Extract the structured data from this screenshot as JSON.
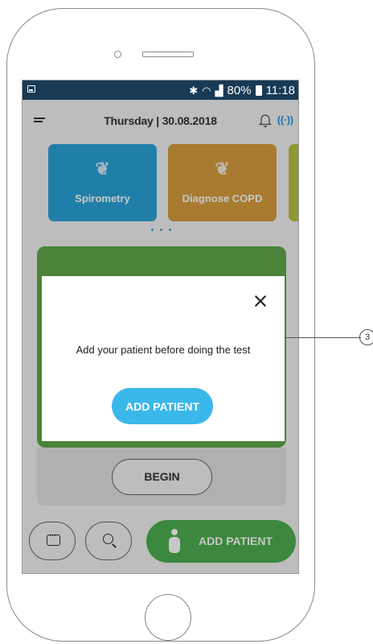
{
  "status_bar": {
    "battery": "80%",
    "time": "11:18"
  },
  "header": {
    "date_title": "Thursday | 30.08.2018"
  },
  "cards": [
    {
      "label": "Spirometry",
      "color": "#2aa3d8"
    },
    {
      "label": "Diagnose COPD",
      "color": "#d89e3e"
    }
  ],
  "begin_button": "BEGIN",
  "bottom_bar": {
    "add_patient": "ADD PATIENT"
  },
  "modal": {
    "message": "Add your patient before doing the test",
    "add_patient_button": "ADD PATIENT"
  },
  "callout": {
    "number": "3"
  },
  "colors": {
    "status_bar": "#183a54",
    "accent_blue": "#3ab8ea",
    "accent_green": "#4caf50"
  }
}
